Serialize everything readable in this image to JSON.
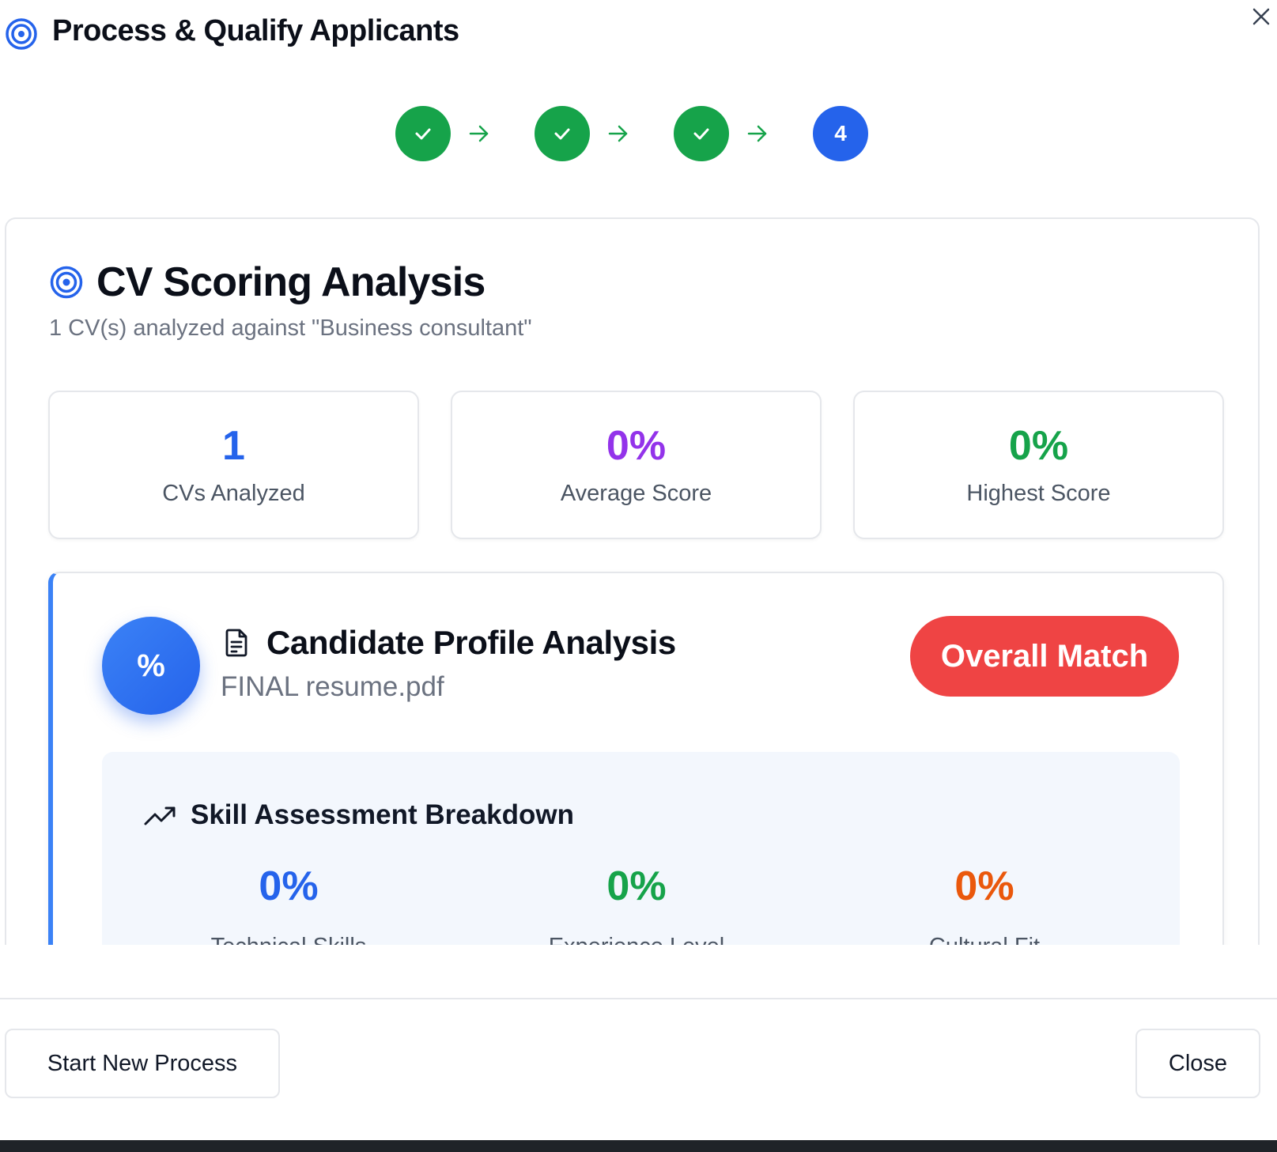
{
  "dialog": {
    "title": "Process & Qualify Applicants",
    "icon": "target-icon",
    "close_icon": "close-icon"
  },
  "stepper": {
    "steps": [
      {
        "state": "done",
        "icon": "check-icon"
      },
      {
        "state": "done",
        "icon": "check-icon"
      },
      {
        "state": "done",
        "icon": "check-icon"
      },
      {
        "state": "active",
        "label": "4"
      }
    ]
  },
  "analysis": {
    "title": "CV Scoring Analysis",
    "subtitle": "1 CV(s) analyzed against \"Business consultant\"",
    "stats": [
      {
        "value": "1",
        "label": "CVs Analyzed",
        "color": "#2563eb"
      },
      {
        "value": "0%",
        "label": "Average Score",
        "color": "#9333ea"
      },
      {
        "value": "0%",
        "label": "Highest Score",
        "color": "#16a34a"
      }
    ]
  },
  "candidate": {
    "badge": "%",
    "title": "Candidate Profile Analysis",
    "file_name": "FINAL resume.pdf",
    "match_label": "Overall Match",
    "match_color": "#ef4444",
    "skills": {
      "title": "Skill Assessment Breakdown",
      "items": [
        {
          "value": "0%",
          "label": "Technical Skills",
          "color": "#2563eb"
        },
        {
          "value": "0%",
          "label": "Experience Level",
          "color": "#16a34a"
        },
        {
          "value": "0%",
          "label": "Cultural Fit",
          "color": "#ea580c"
        }
      ]
    }
  },
  "footer": {
    "start_label": "Start New Process",
    "close_label": "Close"
  },
  "colors": {
    "accent": "#2563eb",
    "success": "#16a34a",
    "danger": "#ef4444"
  }
}
